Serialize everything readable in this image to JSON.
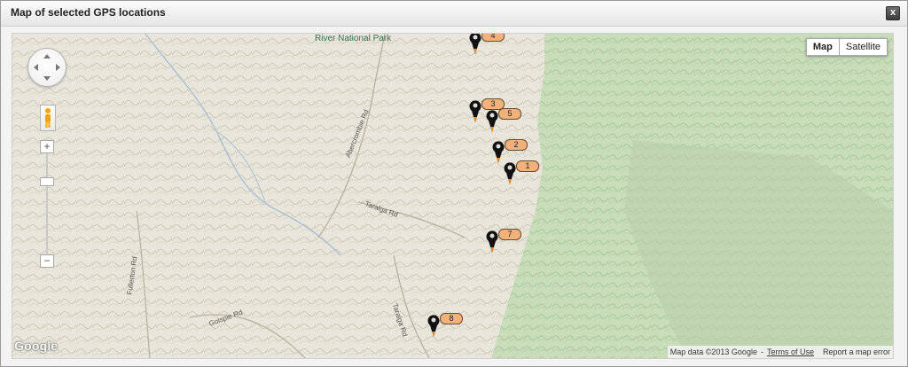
{
  "dialog": {
    "title": "Map of selected GPS locations",
    "close_label": "x"
  },
  "map": {
    "type_buttons": [
      "Map",
      "Satellite"
    ],
    "active_type": "Map",
    "zoom_in_label": "+",
    "zoom_out_label": "−",
    "park_label": "River National Park",
    "road_labels": [
      "Abercrombie Rd",
      "Taralga Rd",
      "Taralga Rd",
      "Fullerton Rd",
      "Golspie Rd"
    ],
    "markers": [
      {
        "label": "1"
      },
      {
        "label": "2"
      },
      {
        "label": "3"
      },
      {
        "label": "4"
      },
      {
        "label": "5"
      },
      {
        "label": "7"
      },
      {
        "label": "8"
      }
    ],
    "logo": "Google",
    "attribution": "Map data ©2013 Google",
    "terms_label": "Terms of Use",
    "report_label": "Report a map error"
  }
}
